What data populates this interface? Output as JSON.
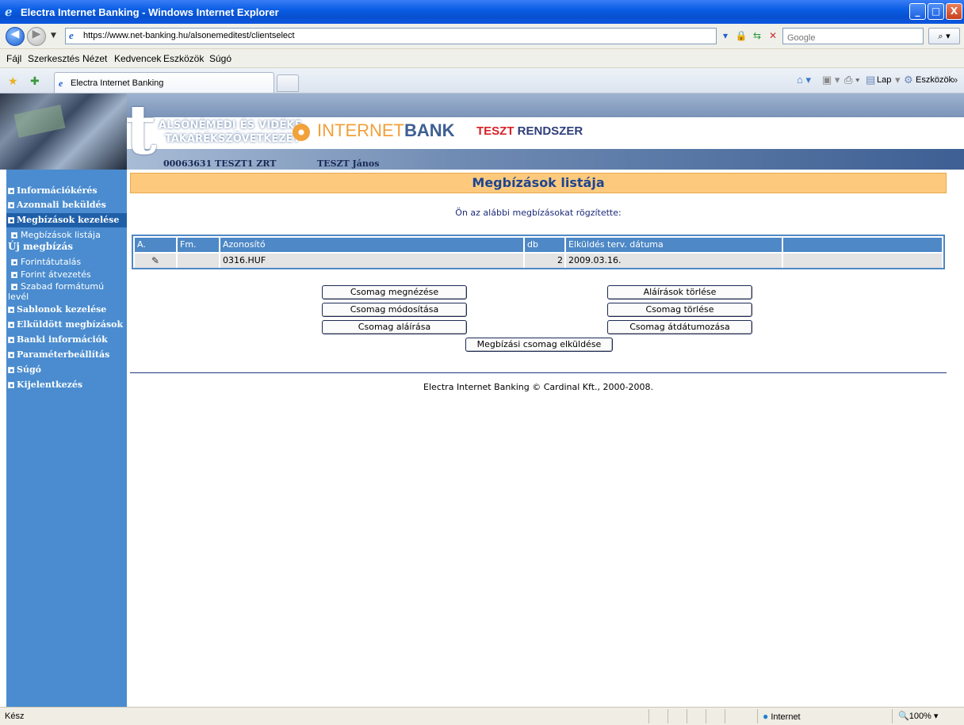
{
  "window": {
    "title": "Electra Internet Banking - Windows Internet Explorer",
    "min_btn": "_",
    "max_btn": "□",
    "close_btn": "X"
  },
  "address": {
    "url": "https://www.net-banking.hu/alsonemeditest/clientselect",
    "search_placeholder": "Google"
  },
  "menu": [
    "Fájl",
    "Szerkesztés",
    "Nézet",
    "Kedvencek",
    "Eszközök",
    "Súgó"
  ],
  "tabs": {
    "active_label": "Electra Internet Banking"
  },
  "commands": {
    "page": "Lap",
    "tools": "Eszközök"
  },
  "banner": {
    "bank_line1": "ALSÓNÉMEDI ÉS VIDÉKE",
    "bank_line2": "TAKARÉKSZÖVETKEZET",
    "internet": "INTERNET",
    "bank": "BANK",
    "teszt_red": "TESZT",
    "teszt_blue": " RENDSZER",
    "client": "00063631  TESZT1 ZRT",
    "user": "TESZT János"
  },
  "sidebar": {
    "items": [
      {
        "label": "Információkérés"
      },
      {
        "label": "Azonnali beküldés"
      },
      {
        "label": "Megbízások kezelése"
      },
      {
        "label": "Megbízások listája"
      },
      {
        "label": "Új megbízás"
      },
      {
        "label": "Forintátutalás"
      },
      {
        "label": "Forint átvezetés"
      },
      {
        "label": "Szabad formátumú"
      },
      {
        "label": "levél"
      },
      {
        "label": "Sablonok kezelése"
      },
      {
        "label": "Elküldött megbízások"
      },
      {
        "label": "Banki információk"
      },
      {
        "label": "Paraméterbeállítás"
      },
      {
        "label": "Súgó"
      },
      {
        "label": "Kijelentkezés"
      }
    ]
  },
  "main": {
    "title": "Megbízások listája",
    "intro": "Ön az alábbi megbízásokat rögzítette:",
    "table": {
      "headers": [
        "A.",
        "Fm.",
        "Azonosító",
        "db",
        "Elküldés terv. dátuma",
        ""
      ],
      "rows": [
        {
          "a": "✎",
          "fm": "",
          "azonosito": "0316.HUF",
          "db": "2",
          "datum": "2009.03.16.",
          "extra": ""
        }
      ]
    },
    "buttons": {
      "view": "Csomag megnézése",
      "modify": "Csomag módosítása",
      "sign": "Csomag aláírása",
      "delete_signatures": "Aláírások törlése",
      "delete_package": "Csomag törlése",
      "redate": "Csomag átdátumozása",
      "send": "Megbízási csomag elküldése"
    },
    "footer": "Electra Internet Banking © Cardinal Kft., 2000-2008."
  },
  "status": {
    "text": "Kész",
    "zone": "Internet",
    "zoom": "100%"
  },
  "colors": {
    "sidebar_bg": "#4a8ccf",
    "title_bar_bg": "#fdca7d",
    "table_header": "#4e88c6",
    "title_text": "#1f4590"
  }
}
